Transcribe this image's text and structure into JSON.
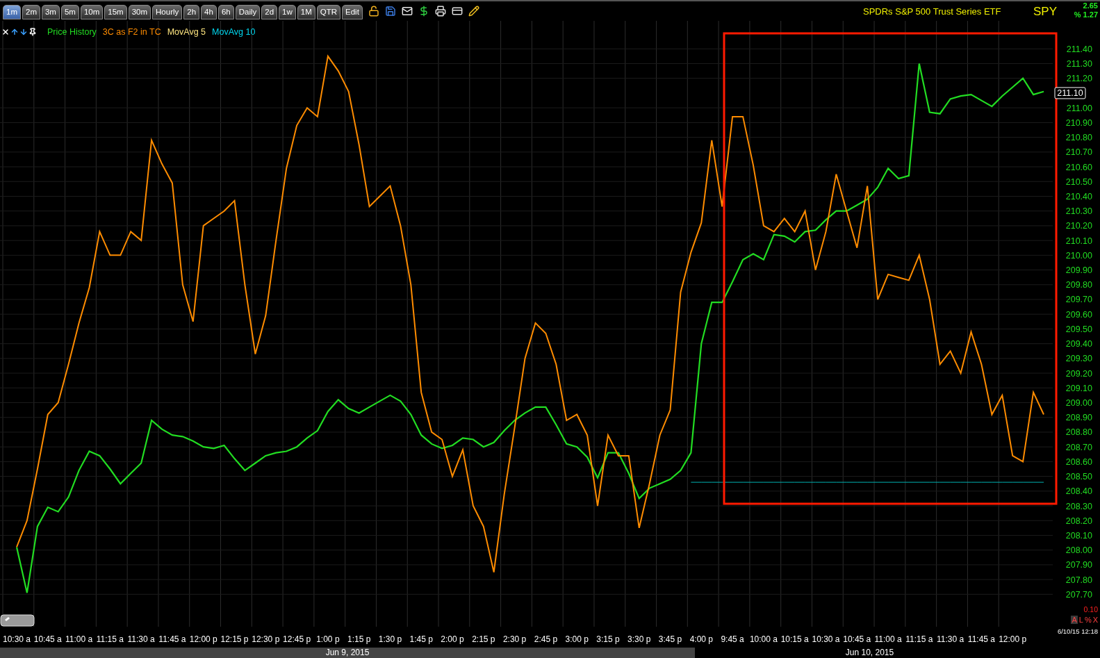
{
  "toolbar": {
    "tabs": [
      {
        "label": "1m",
        "selected": true
      },
      {
        "label": "2m",
        "selected": false
      },
      {
        "label": "3m",
        "selected": false
      },
      {
        "label": "5m",
        "selected": false
      },
      {
        "label": "10m",
        "selected": false
      },
      {
        "label": "15m",
        "selected": false
      },
      {
        "label": "30m",
        "selected": false
      },
      {
        "label": "Hourly",
        "selected": false
      },
      {
        "label": "2h",
        "selected": false
      },
      {
        "label": "4h",
        "selected": false
      },
      {
        "label": "6h",
        "selected": false
      },
      {
        "label": "Daily",
        "selected": false
      },
      {
        "label": "2d",
        "selected": false
      },
      {
        "label": "1w",
        "selected": false
      },
      {
        "label": "1M",
        "selected": false
      },
      {
        "label": "QTR",
        "selected": false
      },
      {
        "label": "Edit",
        "selected": false
      }
    ]
  },
  "header": {
    "instrument_name": "SPDRs S&P 500 Trust Series ETF",
    "symbol": "SPY",
    "change": "2.65",
    "percent_change": "% 1.27"
  },
  "legend": [
    {
      "label": "MovAvg 5",
      "color": "#ffe680"
    },
    {
      "label": "MovAvg 10",
      "color": "#00d8f0"
    }
  ],
  "chart": {
    "chart_data": {
      "type": "line",
      "grid": true,
      "ylim": [
        207.48,
        211.59
      ],
      "categories": [
        "10:30 a",
        null,
        null,
        "10:45 a",
        null,
        null,
        "11:00 a",
        null,
        null,
        "11:15 a",
        null,
        null,
        "11:30 a",
        null,
        null,
        "11:45 a",
        null,
        null,
        "12:00 p",
        null,
        null,
        "12:15 p",
        null,
        null,
        "12:30 p",
        null,
        null,
        "12:45 p",
        null,
        null,
        "1:00 p",
        null,
        null,
        "1:15 p",
        null,
        null,
        "1:30 p",
        null,
        null,
        "1:45 p",
        null,
        null,
        "2:00 p",
        null,
        null,
        "2:15 p",
        null,
        null,
        "2:30 p",
        null,
        null,
        "2:45 p",
        null,
        null,
        "3:00 p",
        null,
        null,
        "3:15 p",
        null,
        null,
        "3:30 p",
        null,
        null,
        "3:45 p",
        null,
        null,
        "4:00 p",
        null,
        null,
        "9:45 a",
        null,
        null,
        "10:00 a",
        null,
        null,
        "10:15 a",
        null,
        null,
        "10:30 a",
        null,
        null,
        "10:45 a",
        null,
        null,
        "11:00 a",
        null,
        null,
        "11:15 a",
        null,
        null,
        "11:30 a",
        null,
        null,
        "11:45 a",
        null,
        null,
        "12:00 p",
        null,
        null,
        null
      ],
      "yticks": [
        {
          "value": 211.4,
          "label": "211.40"
        },
        {
          "value": 211.3,
          "label": "211.30"
        },
        {
          "value": 211.2,
          "label": "211.20"
        },
        {
          "value": 211.0,
          "label": "211.00"
        },
        {
          "value": 210.9,
          "label": "210.90"
        },
        {
          "value": 210.8,
          "label": "210.80"
        },
        {
          "value": 210.7,
          "label": "210.70"
        },
        {
          "value": 210.6,
          "label": "210.60"
        },
        {
          "value": 210.5,
          "label": "210.50"
        },
        {
          "value": 210.4,
          "label": "210.40"
        },
        {
          "value": 210.3,
          "label": "210.30"
        },
        {
          "value": 210.2,
          "label": "210.20"
        },
        {
          "value": 210.1,
          "label": "210.10"
        },
        {
          "value": 210.0,
          "label": "210.00"
        },
        {
          "value": 209.9,
          "label": "209.90"
        },
        {
          "value": 209.8,
          "label": "209.80"
        },
        {
          "value": 209.7,
          "label": "209.70"
        },
        {
          "value": 209.6,
          "label": "209.60"
        },
        {
          "value": 209.5,
          "label": "209.50"
        },
        {
          "value": 209.4,
          "label": "209.40"
        },
        {
          "value": 209.3,
          "label": "209.30"
        },
        {
          "value": 209.2,
          "label": "209.20"
        },
        {
          "value": 209.1,
          "label": "209.10"
        },
        {
          "value": 209.0,
          "label": "209.00"
        },
        {
          "value": 208.9,
          "label": "208.90"
        },
        {
          "value": 208.8,
          "label": "208.80"
        },
        {
          "value": 208.7,
          "label": "208.70"
        },
        {
          "value": 208.6,
          "label": "208.60"
        },
        {
          "value": 208.5,
          "label": "208.50"
        },
        {
          "value": 208.4,
          "label": "208.40"
        },
        {
          "value": 208.3,
          "label": "208.30"
        },
        {
          "value": 208.2,
          "label": "208.20"
        },
        {
          "value": 208.1,
          "label": "208.10"
        },
        {
          "value": 208.0,
          "label": "208.00"
        },
        {
          "value": 207.9,
          "label": "207.90"
        },
        {
          "value": 207.8,
          "label": "207.80"
        },
        {
          "value": 207.7,
          "label": "207.70"
        }
      ],
      "series": [
        {
          "name": "Price History",
          "color": "#22dd22",
          "values": [
            208.02,
            207.71,
            208.16,
            208.29,
            208.26,
            208.36,
            208.54,
            208.67,
            208.64,
            208.55,
            208.45,
            208.52,
            208.59,
            208.88,
            208.82,
            208.78,
            208.77,
            208.74,
            208.7,
            208.69,
            208.71,
            208.62,
            208.54,
            208.59,
            208.64,
            208.66,
            208.67,
            208.7,
            208.76,
            208.81,
            208.94,
            209.02,
            208.96,
            208.93,
            208.97,
            209.01,
            209.05,
            209.01,
            208.92,
            208.78,
            208.72,
            208.69,
            208.71,
            208.76,
            208.75,
            208.7,
            208.73,
            208.81,
            208.88,
            208.93,
            208.97,
            208.97,
            208.85,
            208.72,
            208.7,
            208.63,
            208.49,
            208.66,
            208.66,
            208.52,
            208.35,
            208.42,
            208.45,
            208.48,
            208.54,
            208.66,
            209.4,
            209.68,
            209.68,
            209.82,
            209.97,
            210.01,
            209.97,
            210.14,
            210.13,
            210.09,
            210.16,
            210.17,
            210.24,
            210.3,
            210.3,
            210.34,
            210.38,
            210.46,
            210.59,
            210.52,
            210.54,
            211.3,
            210.97,
            210.96,
            211.06,
            211.08,
            211.09,
            211.05,
            211.01,
            211.08,
            211.14,
            211.2,
            211.09,
            211.11
          ]
        },
        {
          "name": "3C as F2 in TC",
          "color": "#ff8c00",
          "values": [
            208.02,
            208.2,
            208.55,
            208.92,
            209.0,
            209.26,
            209.54,
            209.78,
            210.16,
            210.0,
            210.0,
            210.16,
            210.1,
            210.78,
            210.62,
            210.49,
            209.8,
            209.55,
            210.2,
            210.25,
            210.3,
            210.37,
            209.8,
            209.33,
            209.59,
            210.1,
            210.59,
            210.88,
            211.0,
            210.94,
            211.35,
            211.25,
            211.11,
            210.75,
            210.33,
            210.4,
            210.47,
            210.2,
            209.8,
            209.07,
            208.8,
            208.75,
            208.5,
            208.68,
            208.3,
            208.16,
            207.85,
            208.38,
            208.83,
            209.3,
            209.54,
            209.47,
            209.26,
            208.88,
            208.92,
            208.78,
            208.3,
            208.78,
            208.64,
            208.64,
            208.15,
            208.45,
            208.78,
            208.95,
            209.75,
            210.02,
            210.22,
            210.78,
            210.33,
            210.94,
            210.94,
            210.61,
            210.2,
            210.16,
            210.25,
            210.16,
            210.3,
            209.9,
            210.16,
            210.55,
            210.3,
            210.05,
            210.47,
            209.7,
            209.87,
            209.85,
            209.83,
            210.0,
            209.7,
            209.26,
            209.35,
            209.2,
            209.48,
            209.26,
            208.92,
            209.05,
            208.64,
            208.6,
            209.07,
            208.92
          ]
        },
        {
          "color": "#00b3b3",
          "values": [
            null,
            null,
            null,
            null,
            null,
            null,
            null,
            null,
            null,
            null,
            null,
            null,
            null,
            null,
            null,
            null,
            null,
            null,
            null,
            null,
            null,
            null,
            null,
            null,
            null,
            null,
            null,
            null,
            null,
            null,
            null,
            null,
            null,
            null,
            null,
            null,
            null,
            null,
            null,
            null,
            null,
            null,
            null,
            null,
            null,
            null,
            null,
            null,
            null,
            null,
            null,
            null,
            null,
            null,
            null,
            null,
            null,
            null,
            null,
            null,
            null,
            null,
            null,
            null,
            null,
            208.46,
            208.46,
            208.46,
            208.46,
            208.46,
            208.46,
            208.46,
            208.46,
            208.46,
            208.46,
            208.46,
            208.46,
            208.46,
            208.46,
            208.46,
            208.46,
            208.46,
            208.46,
            208.46,
            208.46,
            208.46,
            208.46,
            208.46,
            208.46,
            208.46,
            208.46,
            208.46,
            208.46,
            208.46,
            208.46,
            208.46,
            208.46,
            208.46,
            208.46,
            208.46
          ]
        }
      ]
    },
    "last_price": "211.10",
    "scale_step": "0.10",
    "scale_buttons": [
      "A",
      "L",
      "%",
      "X"
    ],
    "timestamp": "6/10/15 12:18"
  },
  "dates": [
    {
      "label": "Jun 9, 2015",
      "shaded": true
    },
    {
      "label": "Jun 10, 2015",
      "shaded": false
    }
  ]
}
